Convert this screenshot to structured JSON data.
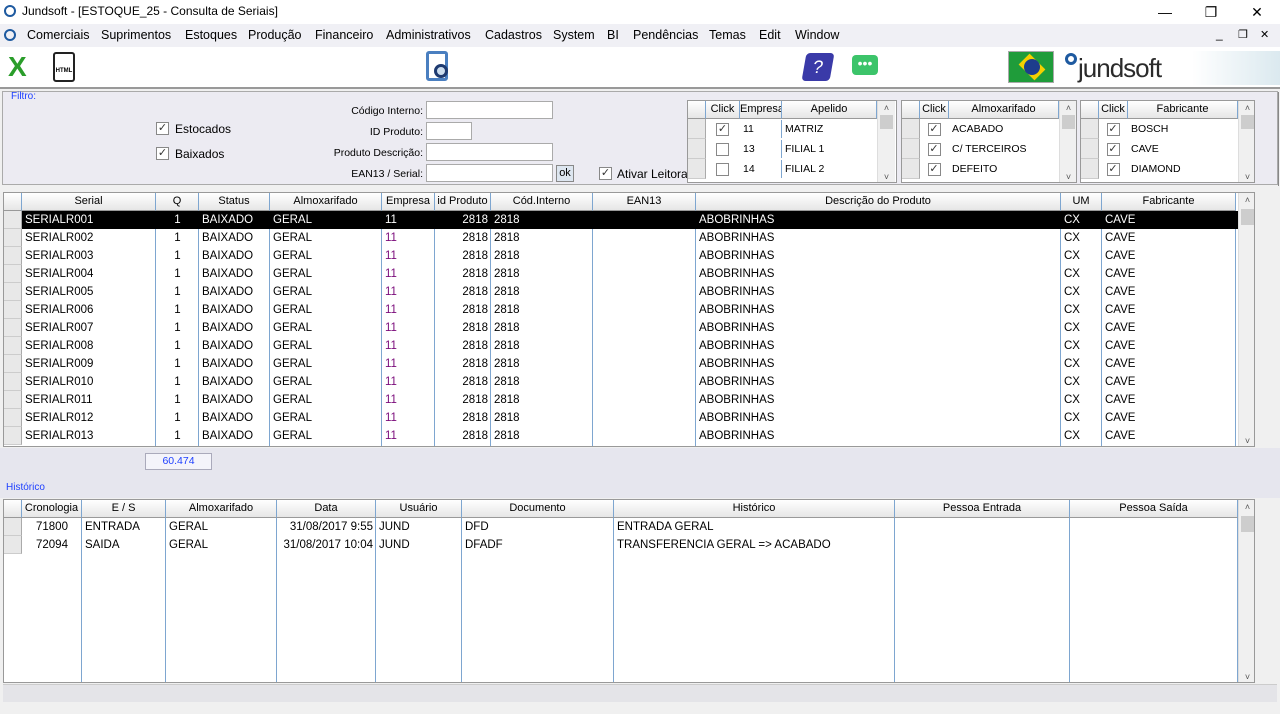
{
  "window": {
    "title": "Jundsoft - [ESTOQUE_25 - Consulta de Seriais]",
    "minimize": "—",
    "restore": "❐",
    "close": "✕"
  },
  "menu": {
    "items": [
      "Comerciais",
      "Suprimentos",
      "Estoques",
      "Produção",
      "Financeiro",
      "Administrativos",
      "Cadastros",
      "System",
      "BI",
      "Pendências",
      "Temas",
      "Edit",
      "Window"
    ],
    "mdi_min": "_",
    "mdi_restore": "❐",
    "mdi_close": "✕"
  },
  "toolbar": {
    "icons": [
      "excel-icon",
      "html-export-icon",
      "document-search-icon",
      "help-book-icon",
      "chat-icon",
      "brazil-flag-icon"
    ],
    "brand": "jundsoft",
    "html_label": "HTML"
  },
  "filtro": {
    "title": "Filtro:",
    "estocados": {
      "label": "Estocados",
      "checked": true
    },
    "baixados": {
      "label": "Baixados",
      "checked": true
    },
    "codigo_interno": {
      "label": "Código Interno:",
      "value": ""
    },
    "id_produto": {
      "label": "ID Produto:",
      "value": ""
    },
    "produto_descricao": {
      "label": "Produto Descrição:",
      "value": ""
    },
    "ean13_serial": {
      "label": "EAN13 / Serial:",
      "value": ""
    },
    "ok": "ok",
    "ativar_leitora": {
      "label": "Ativar Leitora",
      "checked": true
    }
  },
  "empresas": {
    "headers": [
      "Click",
      "Empresa",
      "Apelido"
    ],
    "rows": [
      {
        "checked": true,
        "empresa": "11",
        "apelido": "MATRIZ"
      },
      {
        "checked": false,
        "empresa": "13",
        "apelido": "FILIAL 1"
      },
      {
        "checked": false,
        "empresa": "14",
        "apelido": "FILIAL 2"
      }
    ]
  },
  "almoxarifados": {
    "headers": [
      "Click",
      "Almoxarifado"
    ],
    "rows": [
      {
        "checked": true,
        "name": "ACABADO"
      },
      {
        "checked": true,
        "name": "C/ TERCEIROS"
      },
      {
        "checked": true,
        "name": "DEFEITO"
      }
    ]
  },
  "fabricantes": {
    "headers": [
      "Click",
      "Fabricante"
    ],
    "rows": [
      {
        "checked": true,
        "name": "BOSCH"
      },
      {
        "checked": true,
        "name": "CAVE"
      },
      {
        "checked": true,
        "name": "DIAMOND"
      }
    ]
  },
  "seriais": {
    "headers": [
      "Serial",
      "Q",
      "Status",
      "Almoxarifado",
      "Empresa",
      "id Produto",
      "Cód.Interno",
      "EAN13",
      "Descrição do Produto",
      "UM",
      "Fabricante"
    ],
    "rows": [
      [
        "SERIALR001",
        "1",
        "BAIXADO",
        "GERAL",
        "11",
        "2818",
        "2818",
        "",
        "ABOBRINHAS",
        "CX",
        "CAVE"
      ],
      [
        "SERIALR002",
        "1",
        "BAIXADO",
        "GERAL",
        "11",
        "2818",
        "2818",
        "",
        "ABOBRINHAS",
        "CX",
        "CAVE"
      ],
      [
        "SERIALR003",
        "1",
        "BAIXADO",
        "GERAL",
        "11",
        "2818",
        "2818",
        "",
        "ABOBRINHAS",
        "CX",
        "CAVE"
      ],
      [
        "SERIALR004",
        "1",
        "BAIXADO",
        "GERAL",
        "11",
        "2818",
        "2818",
        "",
        "ABOBRINHAS",
        "CX",
        "CAVE"
      ],
      [
        "SERIALR005",
        "1",
        "BAIXADO",
        "GERAL",
        "11",
        "2818",
        "2818",
        "",
        "ABOBRINHAS",
        "CX",
        "CAVE"
      ],
      [
        "SERIALR006",
        "1",
        "BAIXADO",
        "GERAL",
        "11",
        "2818",
        "2818",
        "",
        "ABOBRINHAS",
        "CX",
        "CAVE"
      ],
      [
        "SERIALR007",
        "1",
        "BAIXADO",
        "GERAL",
        "11",
        "2818",
        "2818",
        "",
        "ABOBRINHAS",
        "CX",
        "CAVE"
      ],
      [
        "SERIALR008",
        "1",
        "BAIXADO",
        "GERAL",
        "11",
        "2818",
        "2818",
        "",
        "ABOBRINHAS",
        "CX",
        "CAVE"
      ],
      [
        "SERIALR009",
        "1",
        "BAIXADO",
        "GERAL",
        "11",
        "2818",
        "2818",
        "",
        "ABOBRINHAS",
        "CX",
        "CAVE"
      ],
      [
        "SERIALR010",
        "1",
        "BAIXADO",
        "GERAL",
        "11",
        "2818",
        "2818",
        "",
        "ABOBRINHAS",
        "CX",
        "CAVE"
      ],
      [
        "SERIALR011",
        "1",
        "BAIXADO",
        "GERAL",
        "11",
        "2818",
        "2818",
        "",
        "ABOBRINHAS",
        "CX",
        "CAVE"
      ],
      [
        "SERIALR012",
        "1",
        "BAIXADO",
        "GERAL",
        "11",
        "2818",
        "2818",
        "",
        "ABOBRINHAS",
        "CX",
        "CAVE"
      ],
      [
        "SERIALR013",
        "1",
        "BAIXADO",
        "GERAL",
        "11",
        "2818",
        "2818",
        "",
        "ABOBRINHAS",
        "CX",
        "CAVE"
      ]
    ],
    "total": "60.474"
  },
  "historico": {
    "title": "Histórico",
    "headers": [
      "Cronologia",
      "E / S",
      "Almoxarifado",
      "Data",
      "Usuário",
      "Documento",
      "Histórico",
      "Pessoa Entrada",
      "Pessoa Saída"
    ],
    "rows": [
      [
        "71800",
        "ENTRADA",
        "GERAL",
        "31/08/2017 9:55",
        "JUND",
        "DFD",
        "ENTRADA GERAL",
        "",
        ""
      ],
      [
        "72094",
        "SAIDA",
        "GERAL",
        "31/08/2017 10:04",
        "JUND",
        "DFADF",
        "TRANSFERENCIA GERAL => ACABADO",
        "",
        ""
      ]
    ]
  },
  "colors": {
    "selected_row": "#000000",
    "empresa_text": "#7a0a7a",
    "accent_blue": "#1e40ff",
    "grid_line": "#7ea6d0"
  }
}
